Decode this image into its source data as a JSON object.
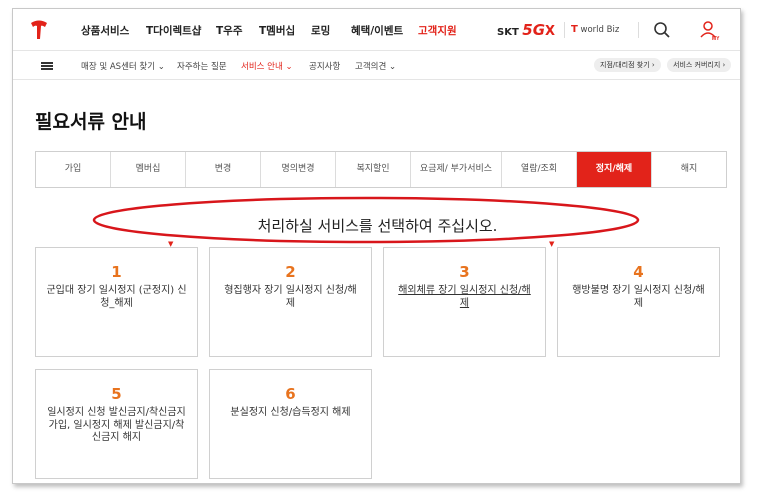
{
  "topnav": {
    "items": [
      "상품서비스",
      "T다이렉트샵",
      "T우주",
      "T멤버십",
      "로밍",
      "혜택/이벤트",
      "고객지원"
    ],
    "active_index": 6,
    "skt_label": "SKT",
    "skt_5g": "5G",
    "skt_x": "X",
    "worldbiz_t": "T",
    "worldbiz_label": "world Biz",
    "user_label": "MY"
  },
  "subnav": {
    "items": [
      "매장 및 AS센터 찾기 ⌄",
      "자주하는 질문",
      "서비스 안내 ⌄",
      "공지사항",
      "고객의견 ⌄"
    ],
    "active_index": 2,
    "pills": [
      "지점/대리점 찾기 ›",
      "서비스 커버리지 ›"
    ]
  },
  "page": {
    "title": "필요서류 안내",
    "instruction": "처리하실 서비스를 선택하여 주십시오."
  },
  "tabs": [
    {
      "label": "가입"
    },
    {
      "label": "멤버십"
    },
    {
      "label": "변경"
    },
    {
      "label": "명의변경"
    },
    {
      "label": "복지할인"
    },
    {
      "label": "요금제/ 부가서비스"
    },
    {
      "label": "열람/조회"
    },
    {
      "label": "정지/해제"
    },
    {
      "label": "해지"
    }
  ],
  "active_tab": 7,
  "cards": [
    {
      "num": "1",
      "label": "군입대 장기 일시정지 (군정지) 신청_해제"
    },
    {
      "num": "2",
      "label": "형집행자 장기 일시정지 신청/해제"
    },
    {
      "num": "3",
      "label": "해외체류 장기 일시정지 신청/해제"
    },
    {
      "num": "4",
      "label": "행방불명 장기 일시정지 신청/해제"
    },
    {
      "num": "5",
      "label": "일시정지 신청 발신금지/착신금지 가입, 일시정지 해제 발신금지/착신금지 해지"
    },
    {
      "num": "6",
      "label": "분실정지 신청/습득정지 해제"
    }
  ],
  "colors": {
    "accent": "#e2231a",
    "number": "#e8731e"
  }
}
